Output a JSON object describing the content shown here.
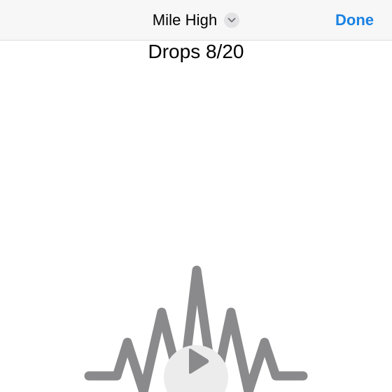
{
  "nav": {
    "title": "Mile High",
    "done_label": "Done",
    "title_menu_icon": "chevron-down-icon",
    "accent_color": "#1a82e2"
  },
  "main": {
    "drops_label": "Drops 8/20",
    "waveform_icon": "waveform-icon",
    "waveform_color": "#8a8a8c",
    "play_icon": "play-icon"
  }
}
